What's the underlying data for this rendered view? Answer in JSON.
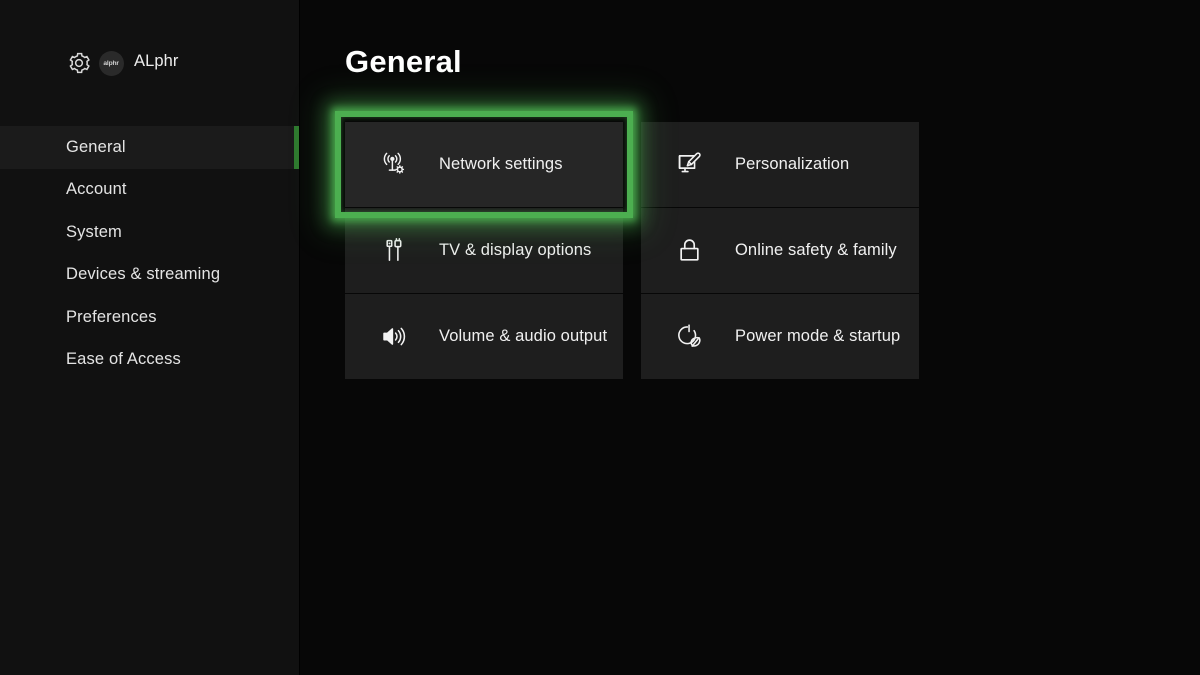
{
  "sidebar": {
    "profile": {
      "gear_icon": "gear-icon",
      "avatar_label": "alphr",
      "gamertag": "ALphr"
    },
    "items": [
      {
        "label": "General",
        "selected": true
      },
      {
        "label": "Account",
        "selected": false
      },
      {
        "label": "System",
        "selected": false
      },
      {
        "label": "Devices & streaming",
        "selected": false
      },
      {
        "label": "Preferences",
        "selected": false
      },
      {
        "label": "Ease of Access",
        "selected": false
      }
    ]
  },
  "main": {
    "title": "General",
    "columns": [
      {
        "tiles": [
          {
            "label": "Network settings",
            "icon": "network-broadcast-gear-icon",
            "selected": true
          },
          {
            "label": "TV & display options",
            "icon": "cable-connectors-icon",
            "selected": false
          },
          {
            "label": "Volume & audio output",
            "icon": "speaker-volume-icon",
            "selected": false
          }
        ]
      },
      {
        "tiles": [
          {
            "label": "Personalization",
            "icon": "monitor-paintbrush-icon",
            "selected": false
          },
          {
            "label": "Online safety & family",
            "icon": "padlock-icon",
            "selected": false
          },
          {
            "label": "Power mode & startup",
            "icon": "power-leaf-icon",
            "selected": false
          }
        ]
      }
    ]
  },
  "colors": {
    "accent_green": "#4caf50",
    "nav_indicator_green": "#2f7a2f",
    "tile_background": "#1e1e1e",
    "sidebar_background": "#111111",
    "main_background": "#070707"
  }
}
